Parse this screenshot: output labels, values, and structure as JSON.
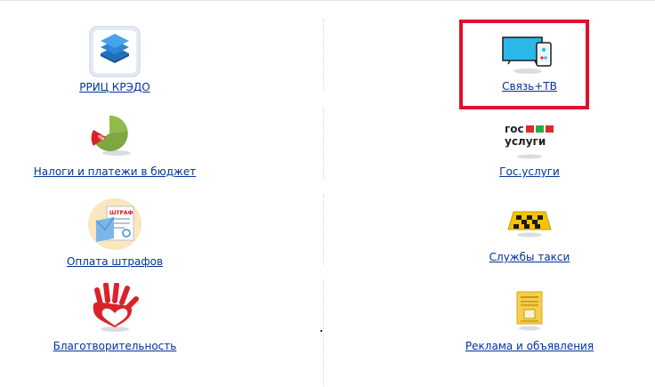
{
  "services": {
    "left": [
      {
        "label": "РРИЦ КРЭДО",
        "icon": "layers-icon"
      },
      {
        "label": "Налоги и платежи в бюджет",
        "icon": "tax-pie-icon"
      },
      {
        "label": "Оплата штрафов",
        "icon": "fine-envelope-icon",
        "icon_text": "ШТРАФ"
      },
      {
        "label": "Благотворительность",
        "icon": "charity-hand-heart-icon"
      }
    ],
    "right": [
      {
        "label": "Связь+ТВ",
        "icon": "tv-phone-icon"
      },
      {
        "label": "Гос.услуги",
        "icon": "gosuslugi-logo-icon",
        "logo_line1": "гос",
        "logo_line2": "услуги"
      },
      {
        "label": "Службы такси",
        "icon": "taxi-sign-icon"
      },
      {
        "label": "Реклама и объявления",
        "icon": "newspaper-icon"
      }
    ]
  },
  "highlight": {
    "target": "Связь+ТВ",
    "color": "#e0102a"
  },
  "colors": {
    "link": "#003399",
    "divider": "#d4d4d4"
  }
}
